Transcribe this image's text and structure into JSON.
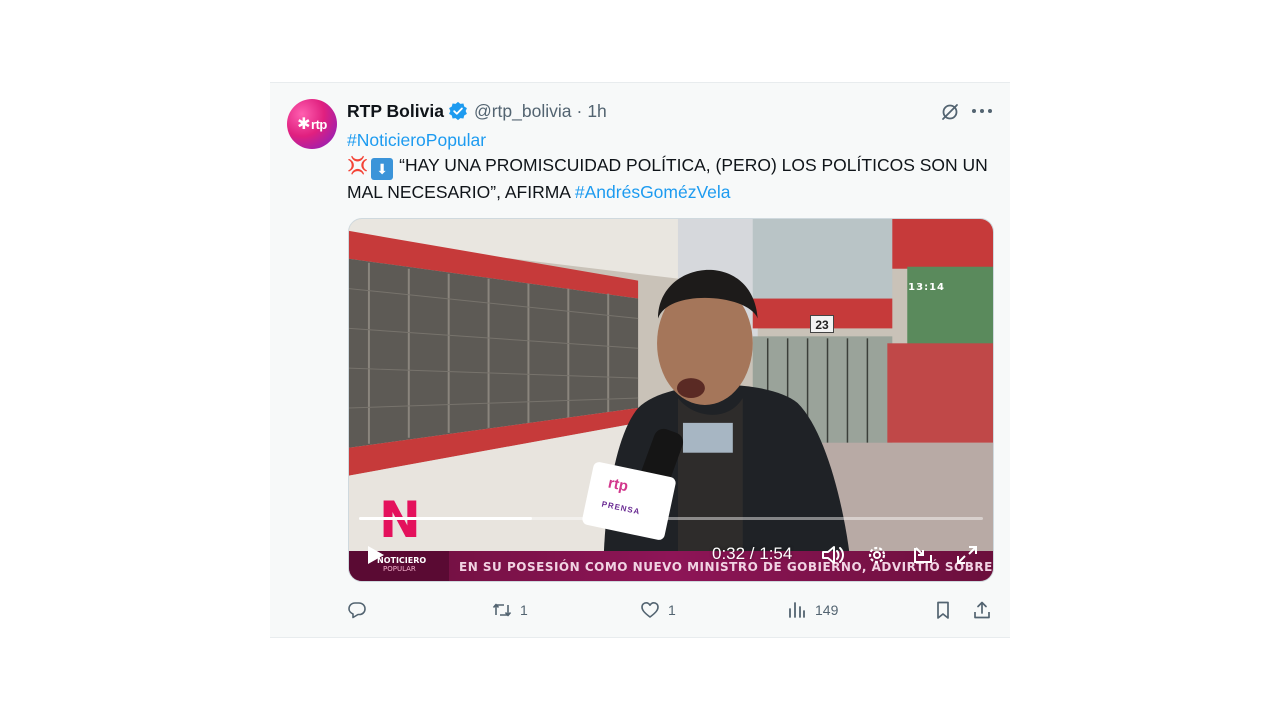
{
  "tweet": {
    "avatar_text": "rtp",
    "author_name": "RTP Bolivia",
    "handle": "@rtp_bolivia",
    "separator": "·",
    "time": "1h",
    "hashtag_1": "#NoticieroPopular",
    "body_text": "“HAY UNA PROMISCUIDAD POLÍTICA, (PERO) LOS POLÍTICOS SON UN MAL NECESARIO”, AFIRMA",
    "hashtag_2": "#AndrésGomézVela",
    "emoji_1": "💢",
    "emoji_2": "⬇"
  },
  "video": {
    "overlay_clock": "13:14",
    "gate_number": "23",
    "mic_brand": "rtp",
    "mic_label": "PRENSA",
    "logo_letter": "N",
    "logo_label": "NOTICIERO",
    "logo_sublabel": "POPULAR",
    "ticker_text": "EN SU POSESIÓN COMO NUEVO MINISTRO DE GOBIERNO, ADVIRTIÓ SOBRE DISCURSO DE O",
    "time_readout": "0:32 / 1:54",
    "progress_fraction": 0.277
  },
  "actions": {
    "replies": "",
    "reposts": "1",
    "likes": "1",
    "views": "149"
  },
  "icons": {
    "verified": "verified-badge-icon",
    "grok": "grok-icon",
    "more": "more-icon",
    "play": "play-icon",
    "volume": "volume-icon",
    "settings": "settings-gear-icon",
    "pip": "picture-in-picture-icon",
    "fullscreen": "fullscreen-icon",
    "reply": "reply-icon",
    "repost": "repost-icon",
    "like": "like-icon",
    "views": "views-icon",
    "bookmark": "bookmark-icon",
    "share": "share-icon"
  },
  "colors": {
    "accent": "#1d9bf0",
    "muted": "#536471",
    "ticker": "#8e1557",
    "avatar_pink": "#e0207f"
  }
}
